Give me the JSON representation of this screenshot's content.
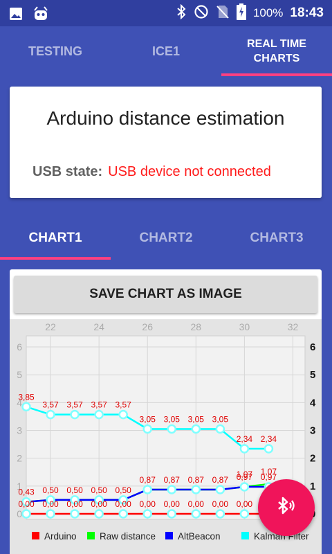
{
  "status_bar": {
    "icons": [
      "image-icon",
      "android-debug-icon",
      "bluetooth-icon",
      "do-not-disturb-icon",
      "no-sim-icon",
      "battery-charging-icon"
    ],
    "battery": "100%",
    "time": "18:43"
  },
  "top_tabs": [
    {
      "label": "TESTING",
      "active": false
    },
    {
      "label": "ICE1",
      "active": false
    },
    {
      "label": "REAL TIME CHARTS",
      "active": true
    }
  ],
  "info_card": {
    "title": "Arduino distance estimation",
    "usb_label": "USB state:",
    "usb_value": "USB device not connected"
  },
  "chart_tabs": [
    {
      "label": "CHART1",
      "active": true
    },
    {
      "label": "CHART2",
      "active": false
    },
    {
      "label": "CHART3",
      "active": false
    }
  ],
  "save_button": "SAVE CHART AS IMAGE",
  "fab_icon": "bluetooth-searching-icon",
  "colors": {
    "primary": "#3F51B5",
    "primary_dark": "#303F9F",
    "accent": "#FF4081",
    "fab": "#F0145A",
    "error_text": "#FF1A1A"
  },
  "chart_data": {
    "type": "line",
    "x": [
      21,
      22,
      23,
      24,
      25,
      26,
      27,
      28,
      29,
      30,
      31,
      32
    ],
    "x_ticks": [
      "22",
      "24",
      "26",
      "28",
      "30",
      "32"
    ],
    "y_ticks_left": [
      "0",
      "1",
      "2",
      "3",
      "4",
      "5",
      "6"
    ],
    "y_ticks_right": [
      "0",
      "1",
      "2",
      "3",
      "4",
      "5",
      "6"
    ],
    "xlim": [
      21,
      32.5
    ],
    "ylim": [
      -0.2,
      6.4
    ],
    "grid": true,
    "legend_position": "bottom",
    "series": [
      {
        "name": "Arduino",
        "color": "#FF0000",
        "values": [
          0,
          0,
          0,
          0,
          0,
          0,
          0,
          0,
          0,
          0,
          0,
          0
        ],
        "labels": [
          "0,00",
          "0,00",
          "0,00",
          "0,00",
          "0,00",
          "0,00",
          "0,00",
          "0,00",
          "0,00",
          "0,00",
          "0,00",
          "0,00"
        ]
      },
      {
        "name": "Raw distance",
        "color": "#00FF00",
        "values": [
          0.43,
          0.5,
          0.5,
          0.5,
          0.5,
          0.87,
          0.87,
          0.87,
          0.87,
          0.97,
          1.07
        ],
        "labels": []
      },
      {
        "name": "AltBeacon",
        "color": "#0000FF",
        "values": [
          0.43,
          0.5,
          0.5,
          0.5,
          0.5,
          0.87,
          0.87,
          0.87,
          0.87,
          0.97,
          0.97
        ],
        "labels": [
          "0,43",
          "0,50",
          "0,50",
          "0,50",
          "0,50",
          "0,87",
          "0,87",
          "0,87",
          "0,87",
          "0,97",
          "0,97"
        ]
      },
      {
        "name": "Kalman Filter",
        "color": "#00FFFF",
        "values": [
          3.85,
          3.57,
          3.57,
          3.57,
          3.57,
          3.05,
          3.05,
          3.05,
          3.05,
          2.34,
          2.34
        ],
        "labels": [
          "3,85",
          "3,57",
          "3,57",
          "3,57",
          "3,57",
          "3,05",
          "3,05",
          "3,05",
          "3,05",
          "2,34",
          "2,34"
        ]
      }
    ],
    "extra_labels": [
      "1,07",
      "1,07"
    ]
  }
}
